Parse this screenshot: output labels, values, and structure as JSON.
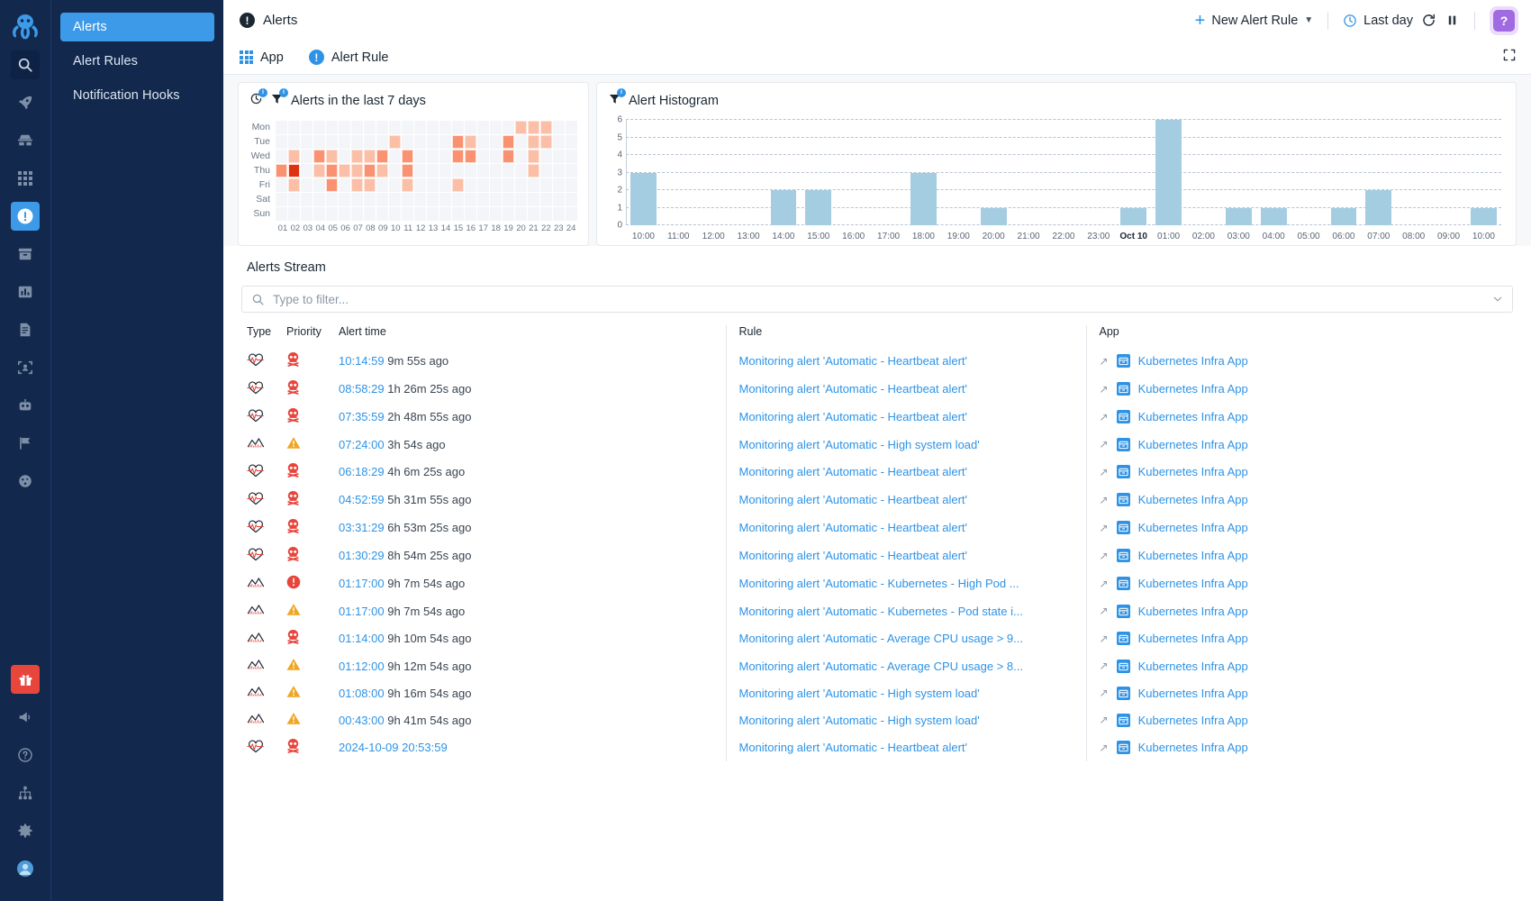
{
  "rail": {
    "logo_icon": "octopus-logo",
    "items": [
      {
        "icon": "search-icon",
        "boxed": true
      },
      {
        "icon": "rocket-icon"
      },
      {
        "icon": "detective-icon"
      },
      {
        "icon": "grid-apps-icon"
      },
      {
        "icon": "alerts-icon",
        "active": true
      },
      {
        "icon": "archive-icon"
      },
      {
        "icon": "bar-chart-icon"
      },
      {
        "icon": "document-icon"
      },
      {
        "icon": "scan-user-icon"
      },
      {
        "icon": "robot-icon"
      },
      {
        "icon": "flag-icon"
      },
      {
        "icon": "globe-grid-icon"
      }
    ],
    "bottom_items": [
      {
        "icon": "gift-icon"
      },
      {
        "icon": "megaphone-icon"
      },
      {
        "icon": "help-circle-icon"
      },
      {
        "icon": "network-icon"
      },
      {
        "icon": "settings-gear-icon"
      },
      {
        "icon": "avatar-icon"
      }
    ]
  },
  "sidebar": {
    "items": [
      {
        "label": "Alerts",
        "active": true
      },
      {
        "label": "Alert Rules",
        "active": false
      },
      {
        "label": "Notification Hooks",
        "active": false
      }
    ]
  },
  "header": {
    "title": "Alerts",
    "title_icon": "alert-exclamation-icon",
    "new_alert_rule_label": "New Alert Rule",
    "time_range_label": "Last day",
    "time_range_icon": "clock-icon",
    "refresh_icon": "refresh-icon",
    "pause_icon": "pause-icon",
    "help_icon": "question-mark-icon"
  },
  "tabs": [
    {
      "label": "App",
      "icon": "grid-icon"
    },
    {
      "label": "Alert Rule",
      "icon": "alert-exclamation-icon"
    }
  ],
  "expand_icon": "fullscreen-icon",
  "chart_data": [
    {
      "type": "heatmap",
      "title": "Alerts in the last 7 days",
      "icons": [
        "clock-badge-icon",
        "filter-badge-icon"
      ],
      "ylabel": "",
      "xlabel": "",
      "rows": [
        "Mon",
        "Tue",
        "Wed",
        "Thu",
        "Fri",
        "Sat",
        "Sun"
      ],
      "categories": [
        "01",
        "02",
        "03",
        "04",
        "05",
        "06",
        "07",
        "08",
        "09",
        "10",
        "11",
        "12",
        "13",
        "14",
        "15",
        "16",
        "17",
        "18",
        "19",
        "20",
        "21",
        "22",
        "23",
        "24"
      ],
      "colorscale": [
        "#f3f5f8",
        "#fbbfa8",
        "#fa9272",
        "#f4633a",
        "#e03110"
      ],
      "values": [
        [
          0,
          0,
          0,
          0,
          0,
          0,
          0,
          0,
          0,
          0,
          0,
          0,
          0,
          0,
          0,
          0,
          0,
          0,
          0,
          1,
          1,
          1,
          0,
          0
        ],
        [
          0,
          0,
          0,
          0,
          0,
          0,
          0,
          0,
          0,
          1,
          0,
          0,
          0,
          0,
          2,
          1,
          0,
          0,
          2,
          0,
          1,
          1,
          0,
          0
        ],
        [
          0,
          1,
          0,
          2,
          1,
          0,
          1,
          1,
          2,
          0,
          2,
          0,
          0,
          0,
          2,
          2,
          0,
          0,
          2,
          0,
          1,
          0,
          0,
          0
        ],
        [
          2,
          4,
          0,
          1,
          2,
          1,
          1,
          2,
          1,
          0,
          2,
          0,
          0,
          0,
          0,
          0,
          0,
          0,
          0,
          0,
          1,
          0,
          0,
          0
        ],
        [
          0,
          1,
          0,
          0,
          2,
          0,
          1,
          1,
          0,
          0,
          1,
          0,
          0,
          0,
          1,
          0,
          0,
          0,
          0,
          0,
          0,
          0,
          0,
          0
        ],
        [
          0,
          0,
          0,
          0,
          0,
          0,
          0,
          0,
          0,
          0,
          0,
          0,
          0,
          0,
          0,
          0,
          0,
          0,
          0,
          0,
          0,
          0,
          0,
          0
        ],
        [
          0,
          0,
          0,
          0,
          0,
          0,
          0,
          0,
          0,
          0,
          0,
          0,
          0,
          0,
          0,
          0,
          0,
          0,
          0,
          0,
          0,
          0,
          0,
          0
        ]
      ]
    },
    {
      "type": "bar",
      "title": "Alert Histogram",
      "icons": [
        "filter-badge-icon"
      ],
      "xlabel": "",
      "ylabel": "",
      "ylim": [
        0,
        6
      ],
      "yticks": [
        0,
        1,
        2,
        3,
        4,
        5,
        6
      ],
      "grid": true,
      "categories": [
        "10:00",
        "11:00",
        "12:00",
        "13:00",
        "14:00",
        "15:00",
        "16:00",
        "17:00",
        "18:00",
        "19:00",
        "20:00",
        "21:00",
        "22:00",
        "23:00",
        "Oct 10",
        "01:00",
        "02:00",
        "03:00",
        "04:00",
        "05:00",
        "06:00",
        "07:00",
        "08:00",
        "09:00",
        "10:00"
      ],
      "bold_ticks": [
        "Oct 10"
      ],
      "values": [
        3,
        0,
        0,
        0,
        2,
        2,
        0,
        0,
        3,
        0,
        1,
        0,
        0,
        0,
        1,
        6,
        0,
        1,
        1,
        0,
        1,
        2,
        0,
        0,
        1
      ],
      "bar_color": "#a4cde2"
    }
  ],
  "stream": {
    "title": "Alerts Stream",
    "filter_placeholder": "Type to filter...",
    "filter_value": "",
    "search_icon": "search-icon",
    "dropdown_icon": "chevron-down-icon",
    "columns": [
      "Type",
      "Priority",
      "Alert time",
      "Rule",
      "App"
    ],
    "rows": [
      {
        "type_icon": "heartbeat-icon",
        "priority_icon": "skull-icon",
        "priority": "skull",
        "time": "10:14:59",
        "ago": "9m 55s ago",
        "rule": "Monitoring alert 'Automatic - Heartbeat alert'",
        "app": "Kubernetes Infra App"
      },
      {
        "type_icon": "heartbeat-icon",
        "priority_icon": "skull-icon",
        "priority": "skull",
        "time": "08:58:29",
        "ago": "1h 26m 25s ago",
        "rule": "Monitoring alert 'Automatic - Heartbeat alert'",
        "app": "Kubernetes Infra App"
      },
      {
        "type_icon": "heartbeat-icon",
        "priority_icon": "skull-icon",
        "priority": "skull",
        "time": "07:35:59",
        "ago": "2h 48m 55s ago",
        "rule": "Monitoring alert 'Automatic - Heartbeat alert'",
        "app": "Kubernetes Infra App"
      },
      {
        "type_icon": "metric-icon",
        "priority_icon": "warning-icon",
        "priority": "warn",
        "time": "07:24:00",
        "ago": "3h 54s ago",
        "rule": "Monitoring alert 'Automatic - High system load'",
        "app": "Kubernetes Infra App"
      },
      {
        "type_icon": "heartbeat-icon",
        "priority_icon": "skull-icon",
        "priority": "skull",
        "time": "06:18:29",
        "ago": "4h 6m 25s ago",
        "rule": "Monitoring alert 'Automatic - Heartbeat alert'",
        "app": "Kubernetes Infra App"
      },
      {
        "type_icon": "heartbeat-icon",
        "priority_icon": "skull-icon",
        "priority": "skull",
        "time": "04:52:59",
        "ago": "5h 31m 55s ago",
        "rule": "Monitoring alert 'Automatic - Heartbeat alert'",
        "app": "Kubernetes Infra App"
      },
      {
        "type_icon": "heartbeat-icon",
        "priority_icon": "skull-icon",
        "priority": "skull",
        "time": "03:31:29",
        "ago": "6h 53m 25s ago",
        "rule": "Monitoring alert 'Automatic - Heartbeat alert'",
        "app": "Kubernetes Infra App"
      },
      {
        "type_icon": "heartbeat-icon",
        "priority_icon": "skull-icon",
        "priority": "skull",
        "time": "01:30:29",
        "ago": "8h 54m 25s ago",
        "rule": "Monitoring alert 'Automatic - Heartbeat alert'",
        "app": "Kubernetes Infra App"
      },
      {
        "type_icon": "metric-icon",
        "priority_icon": "critical-icon",
        "priority": "crit",
        "time": "01:17:00",
        "ago": "9h 7m 54s ago",
        "rule": "Monitoring alert 'Automatic - Kubernetes - High Pod ...",
        "app": "Kubernetes Infra App"
      },
      {
        "type_icon": "metric-icon",
        "priority_icon": "warning-icon",
        "priority": "warn",
        "time": "01:17:00",
        "ago": "9h 7m 54s ago",
        "rule": "Monitoring alert 'Automatic - Kubernetes - Pod state i...",
        "app": "Kubernetes Infra App"
      },
      {
        "type_icon": "metric-icon",
        "priority_icon": "skull-icon",
        "priority": "skull",
        "time": "01:14:00",
        "ago": "9h 10m 54s ago",
        "rule": "Monitoring alert 'Automatic - Average CPU usage > 9...",
        "app": "Kubernetes Infra App"
      },
      {
        "type_icon": "metric-icon",
        "priority_icon": "warning-icon",
        "priority": "warn",
        "time": "01:12:00",
        "ago": "9h 12m 54s ago",
        "rule": "Monitoring alert 'Automatic - Average CPU usage > 8...",
        "app": "Kubernetes Infra App"
      },
      {
        "type_icon": "metric-icon",
        "priority_icon": "warning-icon",
        "priority": "warn",
        "time": "01:08:00",
        "ago": "9h 16m 54s ago",
        "rule": "Monitoring alert 'Automatic - High system load'",
        "app": "Kubernetes Infra App"
      },
      {
        "type_icon": "metric-icon",
        "priority_icon": "warning-icon",
        "priority": "warn",
        "time": "00:43:00",
        "ago": "9h 41m 54s ago",
        "rule": "Monitoring alert 'Automatic - High system load'",
        "app": "Kubernetes Infra App"
      },
      {
        "type_icon": "heartbeat-icon",
        "priority_icon": "skull-icon",
        "priority": "skull",
        "time": "2024-10-09 20:53:59",
        "ago": "",
        "rule": "Monitoring alert 'Automatic - Heartbeat alert'",
        "app": "Kubernetes Infra App"
      }
    ]
  },
  "colors": {
    "accent": "#2e93e6",
    "sidebar_bg": "#12284c",
    "heat_max": "#e03110",
    "bar": "#a4cde2",
    "danger": "#e8453c",
    "warning": "#f0a623"
  }
}
